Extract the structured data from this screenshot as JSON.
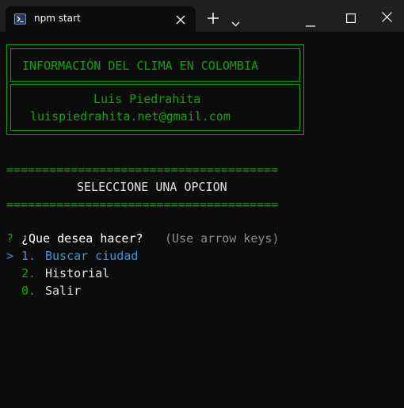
{
  "window": {
    "tab_title": "npm start",
    "icons": {
      "tab": "powershell-icon",
      "close_tab": "close-icon",
      "new_tab": "plus-icon",
      "dropdown": "chevron-down-icon",
      "minimize": "minimize-icon",
      "maximize": "maximize-icon",
      "close": "close-icon"
    }
  },
  "terminal": {
    "header_title": "INFORMACIÓN DEL CLIMA EN COLOMBIA",
    "author_name": "Luis Piedrahita",
    "author_email": "luispiedrahita.net@gmail.com",
    "separator": "======================================",
    "menu_title": "SELECCIONE UNA OPCION",
    "prompt_marker": "?",
    "prompt_question": "¿Que desea hacer?",
    "prompt_hint": "(Use arrow keys)",
    "pointer": ">",
    "options": [
      {
        "number": "1.",
        "label": "Buscar ciudad",
        "selected": true
      },
      {
        "number": "2.",
        "label": "Historial",
        "selected": false
      },
      {
        "number": "0.",
        "label": "Salir",
        "selected": false
      }
    ],
    "colors": {
      "background": "#0c0c0c",
      "green": "#13a10e",
      "selected": "#3a96dd",
      "hint": "#8c8c8c",
      "text": "#e0e0e0"
    }
  }
}
